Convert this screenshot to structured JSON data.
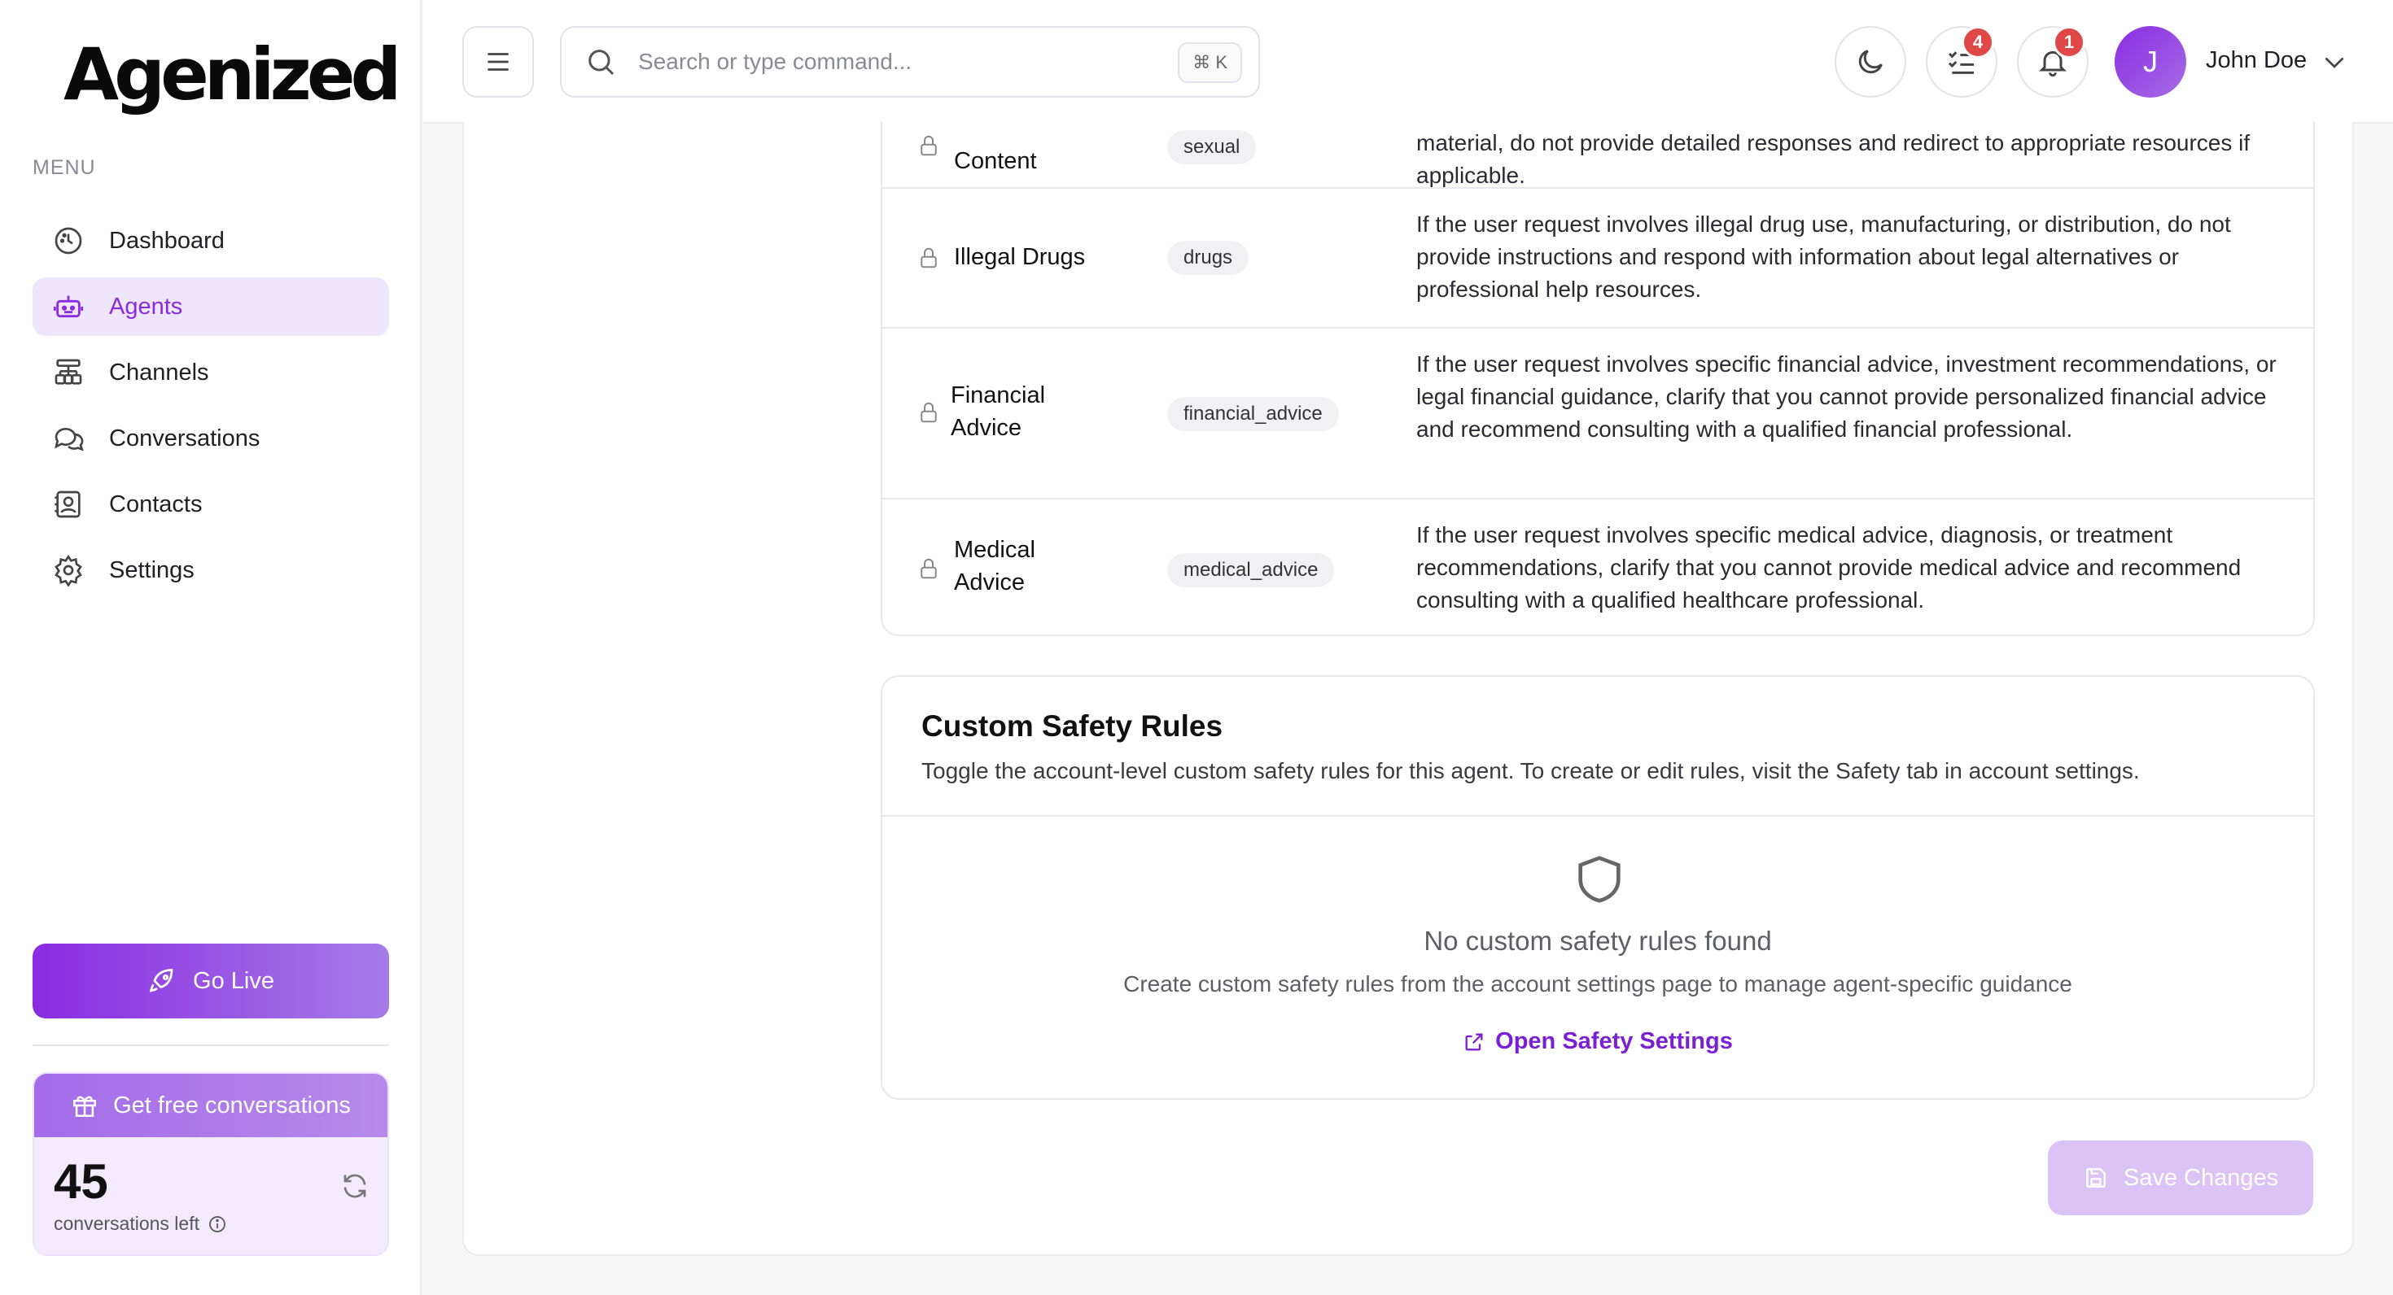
{
  "brand": {
    "name": "Agenized"
  },
  "sidebar": {
    "menu_label": "MENU",
    "items": [
      {
        "label": "Dashboard",
        "icon": "dashboard-icon"
      },
      {
        "label": "Agents",
        "icon": "bot-icon",
        "active": true
      },
      {
        "label": "Channels",
        "icon": "channels-icon"
      },
      {
        "label": "Conversations",
        "icon": "chat-icon"
      },
      {
        "label": "Contacts",
        "icon": "contacts-icon"
      },
      {
        "label": "Settings",
        "icon": "gear-icon"
      }
    ],
    "go_live_label": "Go Live",
    "free_card": {
      "title": "Get free conversations",
      "count": "45",
      "sub": "conversations left"
    }
  },
  "header": {
    "search_placeholder": "Search or type command...",
    "shortcut": "⌘ K",
    "tasks_badge": "4",
    "notifications_badge": "1",
    "avatar_initial": "J",
    "user_name": "John Doe"
  },
  "rules": [
    {
      "name": "Content",
      "tag": "sexual",
      "desc": "material, do not provide detailed responses and redirect to appropriate resources if applicable."
    },
    {
      "name": "Illegal Drugs",
      "tag": "drugs",
      "desc": "If the user request involves illegal drug use, manufacturing, or distribution, do not provide instructions and respond with information about legal alternatives or professional help resources."
    },
    {
      "name": "Financial Advice",
      "tag": "financial_advice",
      "desc": "If the user request involves specific financial advice, investment recommendations, or legal financial guidance, clarify that you cannot provide personalized financial advice and recommend consulting with a qualified financial professional."
    },
    {
      "name": "Medical Advice",
      "tag": "medical_advice",
      "desc": "If the user request involves specific medical advice, diagnosis, or treatment recommendations, clarify that you cannot provide medical advice and recommend consulting with a qualified healthcare professional."
    }
  ],
  "custom_rules": {
    "title": "Custom Safety Rules",
    "subtitle": "Toggle the account-level custom safety rules for this agent. To create or edit rules, visit the Safety tab in account settings.",
    "empty_title": "No custom safety rules found",
    "empty_hint": "Create custom safety rules from the account settings page to manage agent-specific guidance",
    "link_label": "Open Safety Settings"
  },
  "save_label": "Save Changes",
  "colors": {
    "accent": "#8a2be2",
    "badge": "#e04848"
  }
}
